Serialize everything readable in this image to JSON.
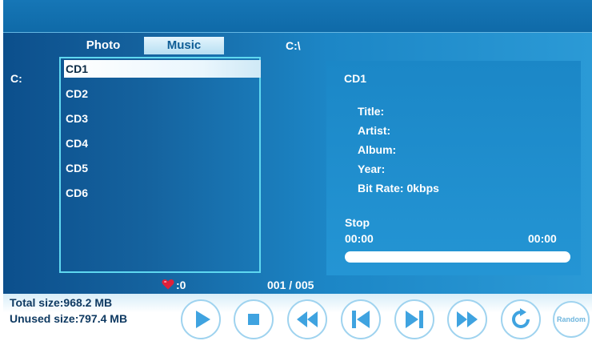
{
  "tabs": {
    "photo": "Photo",
    "music": "Music"
  },
  "path": "C:\\",
  "drive": "C:",
  "file_list": [
    {
      "label": "CD1",
      "selected": true
    },
    {
      "label": "CD2",
      "selected": false
    },
    {
      "label": "CD3",
      "selected": false
    },
    {
      "label": "CD4",
      "selected": false
    },
    {
      "label": "CD5",
      "selected": false
    },
    {
      "label": "CD6",
      "selected": false
    }
  ],
  "info": {
    "name": "CD1",
    "title_label": "Title:",
    "artist_label": "Artist:",
    "album_label": "Album:",
    "year_label": "Year:",
    "bitrate_label": "Bit Rate: 0kbps"
  },
  "playback": {
    "status": "Stop",
    "elapsed": "00:00",
    "total": "00:00",
    "progress_fraction": 0
  },
  "favorites": {
    "icon": "heart-icon",
    "count": ":0"
  },
  "counter": "001 / 005",
  "storage": {
    "total": "Total size:968.2 MB",
    "unused": "Unused size:797.4 MB"
  },
  "controls": {
    "play": "play-icon",
    "stop": "stop-icon",
    "rewind": "rewind-icon",
    "previous": "previous-icon",
    "next": "next-icon",
    "fast_forward": "fast-forward-icon",
    "repeat": "repeat-icon",
    "random_label": "Random"
  },
  "colors": {
    "accent": "#2a97d6",
    "selection": "#ffffff",
    "list_border": "#5fd8f0",
    "button_glyph": "#3fa3e0",
    "heart": "#e0213a"
  }
}
